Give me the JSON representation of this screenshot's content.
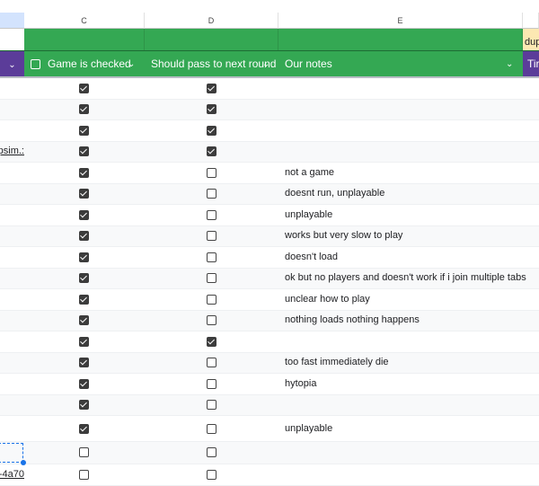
{
  "columns": {
    "c": "C",
    "d": "D",
    "e": "E"
  },
  "top_band": {
    "f_label": "dup"
  },
  "headers": {
    "c": "Game is checked",
    "d": "Should pass to next round",
    "e": "Our notes",
    "f": "Tir"
  },
  "colors": {
    "green": "#34a853",
    "purple": "#5b3c99",
    "yellow": "#fce8b2",
    "selection": "#1a73e8"
  },
  "rows": [
    {
      "b": "",
      "c": true,
      "d": true,
      "e": ""
    },
    {
      "b": "",
      "c": true,
      "d": true,
      "e": ""
    },
    {
      "b": "",
      "c": true,
      "d": true,
      "e": ""
    },
    {
      "b": "psim.:",
      "c": true,
      "d": true,
      "e": ""
    },
    {
      "b": "",
      "c": true,
      "d": false,
      "e": "not a game"
    },
    {
      "b": "",
      "c": true,
      "d": false,
      "e": "doesnt run, unplayable"
    },
    {
      "b": "",
      "c": true,
      "d": false,
      "e": "unplayable"
    },
    {
      "b": "",
      "c": true,
      "d": false,
      "e": "works but very slow to play"
    },
    {
      "b": "",
      "c": true,
      "d": false,
      "e": "doesn't load"
    },
    {
      "b": "",
      "c": true,
      "d": false,
      "e": "ok but no players and doesn't work if i join multiple tabs"
    },
    {
      "b": "",
      "c": true,
      "d": false,
      "e": "unclear how to play"
    },
    {
      "b": "",
      "c": true,
      "d": false,
      "e": "nothing loads nothing happens"
    },
    {
      "b": "",
      "c": true,
      "d": true,
      "e": ""
    },
    {
      "b": "",
      "c": true,
      "d": false,
      "e": "too fast immediately die"
    },
    {
      "b": "",
      "c": true,
      "d": false,
      "e": "hytopia"
    },
    {
      "b": "",
      "c": true,
      "d": false,
      "e": ""
    },
    {
      "b": "",
      "c": true,
      "d": false,
      "e": "unplayable"
    },
    {
      "b": "",
      "c": false,
      "d": false,
      "e": "",
      "selected_b": true
    },
    {
      "b": "-4a70",
      "c": false,
      "d": false,
      "e": ""
    }
  ]
}
